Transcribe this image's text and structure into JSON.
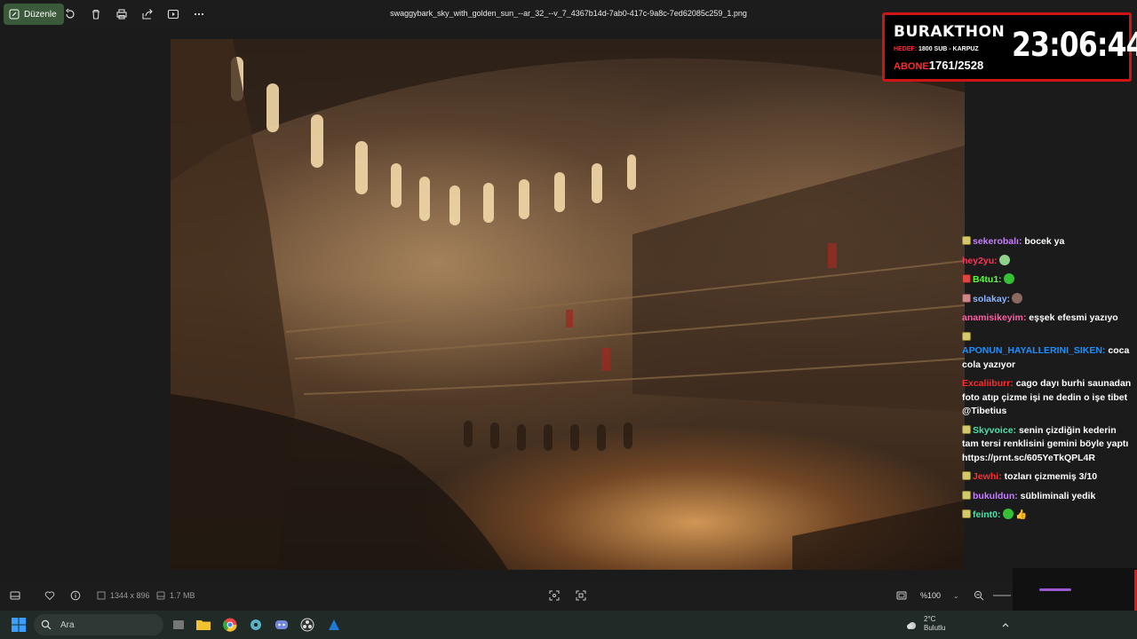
{
  "toolbar": {
    "edit_label": "Düzenle",
    "filename": "swaggybark_sky_with_golden_sun_--ar_32_--v_7_4367b14d-7ab0-417c-9a8c-7ed62085c259_1.png",
    "icons": [
      "rotate-icon",
      "delete-icon",
      "print-icon",
      "share-icon",
      "slideshow-icon",
      "more-icon"
    ]
  },
  "overlay": {
    "title": "BURAKTHON",
    "goal_label": "HEDEF:",
    "goal_text": "1800 SUB - KARPUZ",
    "abone_label": "ABONE",
    "abone_value": "1761/2528",
    "timer": "23:06:44"
  },
  "chat": [
    {
      "user": "sekerobalı:",
      "color": "#c77dff",
      "badge": "yellow",
      "text": "bocek ya",
      "emote": ""
    },
    {
      "user": "hey2yu:",
      "color": "#ff3355",
      "badge": "",
      "text": "",
      "emote": "#8fd18b"
    },
    {
      "user": "B4tu1:",
      "color": "#59ff3a",
      "badge": "red",
      "text": "",
      "emote": "#36c036"
    },
    {
      "user": "solakay:",
      "color": "#8ab4ff",
      "badge": "pink",
      "text": "",
      "emote": "#8a6a60"
    },
    {
      "user": "anamisikeyim:",
      "color": "#ff5fa2",
      "badge": "",
      "text": "eşşek efesmi yazıyo",
      "emote": ""
    },
    {
      "user": "APONUN_HAYALLERINI_SIKEN:",
      "color": "#1f8fff",
      "badge": "yellow",
      "text": "coca cola yazıyor",
      "emote": "",
      "badge_newline": true
    },
    {
      "user": "Excaliiburr:",
      "color": "#ff2d2d",
      "badge": "",
      "text": "cago dayı burhi saunadan foto atıp çizme işi ne dedin o işe tibet @Tibetius",
      "emote": ""
    },
    {
      "user": "Skyvoice:",
      "color": "#4de0a8",
      "badge": "yellow",
      "text": "senin çizdiğin kederin tam tersi renklisini gemini böyle yaptı https://prnt.sc/605YeTkQPL4R",
      "emote": ""
    },
    {
      "user": "Jewhi:",
      "color": "#ff2d2d",
      "badge": "yellow",
      "text": "tozları çizmemiş 3/10",
      "emote": ""
    },
    {
      "user": "bukuldun:",
      "color": "#c77dff",
      "badge": "yellow",
      "text": "sübliminali yedik",
      "emote": ""
    },
    {
      "user": "feint0:",
      "color": "#4de0a8",
      "badge": "yellow",
      "text": "👍",
      "emote": "#36c036"
    }
  ],
  "bottombar": {
    "dimensions": "1344 x 896",
    "filesize": "1.7 MB",
    "zoom": "%100"
  },
  "taskbar": {
    "search_placeholder": "Ara",
    "temperature": "2°C",
    "weather": "Bulutlu"
  }
}
